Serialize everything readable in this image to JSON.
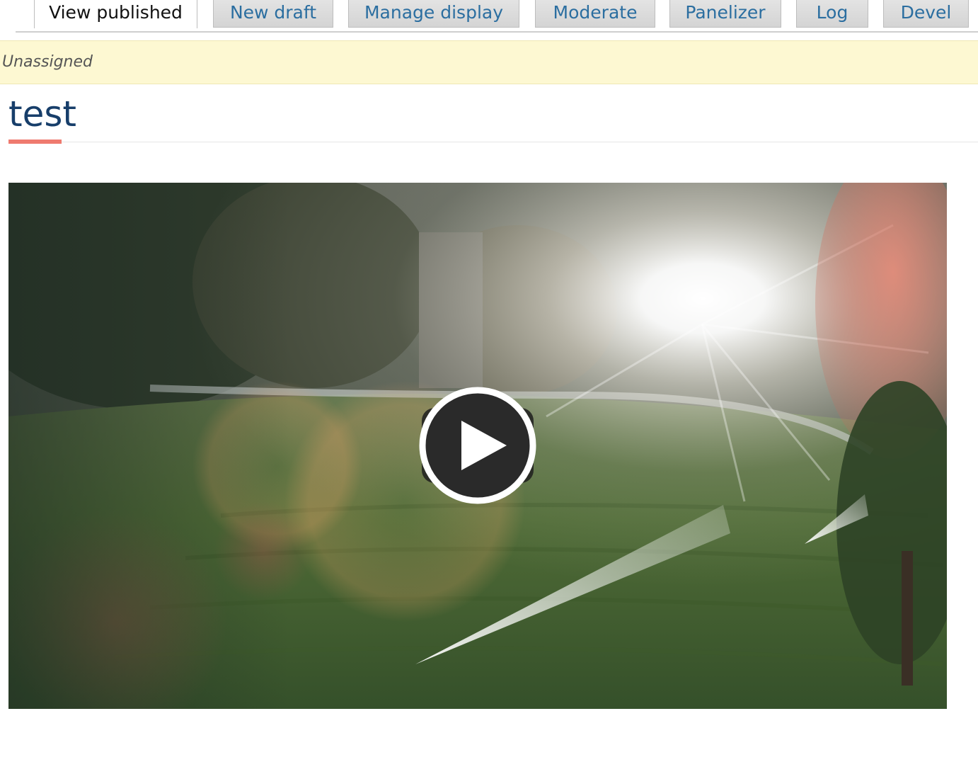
{
  "tabs": [
    {
      "label": "View published",
      "active": true
    },
    {
      "label": "New draft",
      "active": false
    },
    {
      "label": "Manage display",
      "active": false
    },
    {
      "label": "Moderate",
      "active": false
    },
    {
      "label": "Panelizer",
      "active": false
    },
    {
      "label": "Log",
      "active": false
    },
    {
      "label": "Devel",
      "active": false
    }
  ],
  "status": {
    "text": "Unassigned"
  },
  "page": {
    "title": "test"
  },
  "video": {
    "play_icon": "play-icon",
    "thumbnail": "sprinklers-on-lawn-at-sunrise"
  },
  "colors": {
    "accent_underline": "#ef7a6f",
    "title": "#173e6a",
    "tab_link": "#2b6ea0",
    "status_bg": "#fdf8d2"
  }
}
